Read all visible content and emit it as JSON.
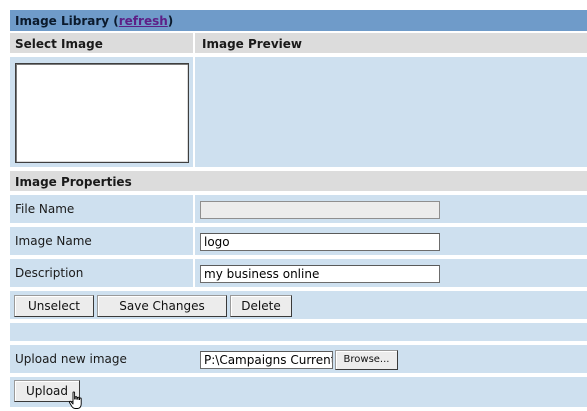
{
  "library": {
    "title": "Image Library (",
    "refresh_link": "refresh",
    "title_close": ")",
    "select_image_header": "Select Image",
    "preview_header": "Image Preview",
    "properties_header": "Image Properties"
  },
  "fields": {
    "file_name_label": "File Name",
    "file_name_value": "",
    "image_name_label": "Image Name",
    "image_name_value": "logo",
    "description_label": "Description",
    "description_value": "my business online"
  },
  "actions": {
    "unselect_label": "Unselect",
    "save_label": "Save Changes",
    "delete_label": "Delete"
  },
  "upload": {
    "label": "Upload new image",
    "path_value": "P:\\Campaigns Current",
    "browse_label": "Browse...",
    "upload_label": "Upload"
  }
}
